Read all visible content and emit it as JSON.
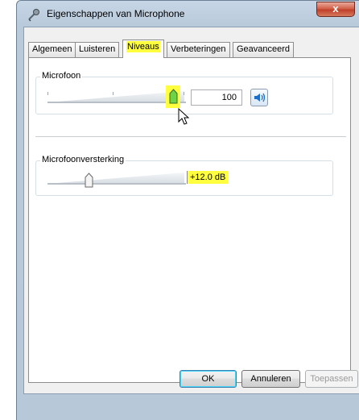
{
  "window": {
    "title": "Eigenschappen van Microphone",
    "close_label": "x",
    "icon": "microphone-icon"
  },
  "tabs": [
    {
      "label": "Algemeen",
      "active": false
    },
    {
      "label": "Luisteren",
      "active": false
    },
    {
      "label": "Niveaus",
      "active": true
    },
    {
      "label": "Verbeteringen",
      "active": false
    },
    {
      "label": "Geavanceerd",
      "active": false
    }
  ],
  "microphone_level": {
    "label": "Microfoon",
    "value": "100",
    "level": 1.0,
    "mute_icon": "speaker-icon"
  },
  "boost": {
    "label": "Microfoonversterking",
    "value": "+12.0 dB",
    "level": 0.29
  },
  "buttons": {
    "ok": "OK",
    "cancel": "Annuleren",
    "apply": "Toepassen"
  },
  "colors": {
    "highlight": "#ffff40",
    "thumb_active": "#6fd34a",
    "close_button": "#c84a33"
  }
}
